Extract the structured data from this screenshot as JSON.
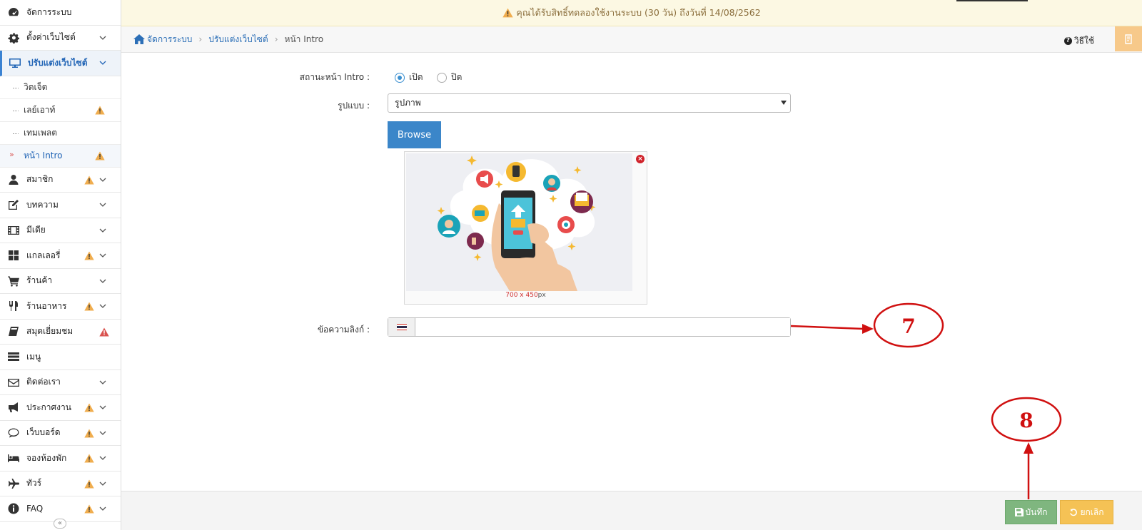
{
  "notice": {
    "text": "คุณได้รับสิทธิ์ทดลองใช้งานระบบ (30 วัน) ถึงวันที่ 14/08/2562"
  },
  "breadcrumb": {
    "items": [
      "จัดการระบบ",
      "ปรับแต่งเว็บไซต์",
      "หน้า Intro"
    ]
  },
  "help": {
    "label": "วิธีใช้"
  },
  "sidebar": {
    "items": [
      {
        "label": "จัดการระบบ",
        "icon": "dashboard-icon"
      },
      {
        "label": "ตั้งค่าเว็บไซต์",
        "icon": "gear-icon"
      },
      {
        "label": "ปรับแต่งเว็บไซต์",
        "icon": "monitor-icon"
      },
      {
        "label": "สมาชิก",
        "icon": "user-icon"
      },
      {
        "label": "บทความ",
        "icon": "edit-icon"
      },
      {
        "label": "มีเดีย",
        "icon": "film-icon"
      },
      {
        "label": "แกลเลอรี่",
        "icon": "grid-icon"
      },
      {
        "label": "ร้านค้า",
        "icon": "cart-icon"
      },
      {
        "label": "ร้านอาหาร",
        "icon": "cutlery-icon"
      },
      {
        "label": "สมุดเยี่ยมชม",
        "icon": "book-icon"
      },
      {
        "label": "เมนู",
        "icon": "menu-list-icon"
      },
      {
        "label": "ติดต่อเรา",
        "icon": "envelope-icon"
      },
      {
        "label": "ประกาศงาน",
        "icon": "megaphone-icon"
      },
      {
        "label": "เว็บบอร์ด",
        "icon": "comments-icon"
      },
      {
        "label": "จองห้องพัก",
        "icon": "bed-icon"
      },
      {
        "label": "ทัวร์",
        "icon": "plane-icon"
      },
      {
        "label": "FAQ",
        "icon": "info-icon"
      }
    ],
    "subitems": [
      "วิดเจ็ต",
      "เลย์เอาท์",
      "เทมเพลต",
      "หน้า Intro"
    ]
  },
  "form": {
    "status_label": "สถานะหน้า Intro :",
    "radio_open": "เปิด",
    "radio_close": "ปิด",
    "status_selected": "เปิด",
    "style_label": "รูปแบบ :",
    "style_value": "รูปภาพ",
    "browse_label": "Browse",
    "image_size": "700 x 450",
    "image_size_unit": "px",
    "link_label": "ข้อความลิงก์ :",
    "link_value": ""
  },
  "buttons": {
    "save": "บันทึก",
    "cancel": "ยกเลิก"
  },
  "annotations": {
    "step7": "7",
    "step8": "8"
  },
  "colors": {
    "accent": "#3b86c9",
    "warning": "#f0ad4e",
    "annotation": "#d01010",
    "save": "#7fb67f",
    "cancel": "#f5c255"
  }
}
